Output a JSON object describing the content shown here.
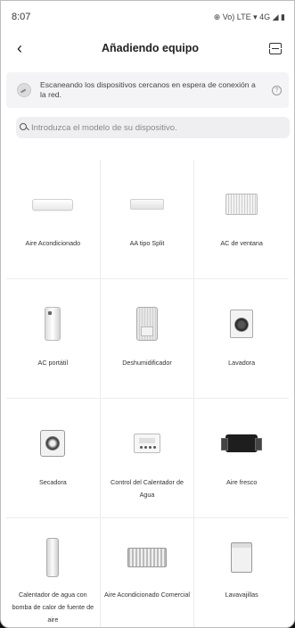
{
  "status_bar": {
    "time": "8:07",
    "icons": "⊕ Vo) LTE ▾ 4G ◢ ▮"
  },
  "header": {
    "title": "Añadiendo equipo"
  },
  "scan_notice": {
    "text": "Escaneando los dispositivos cercanos en espera de conexión a la red.",
    "help": "?"
  },
  "search": {
    "placeholder": "Introduzca el modelo de su dispositivo."
  },
  "devices": [
    {
      "label": "Aire Acondicionado",
      "icon": "split-ac-icon"
    },
    {
      "label": "AA tipo Split",
      "icon": "split-ac-icon"
    },
    {
      "label": "AC de ventana",
      "icon": "window-ac-icon"
    },
    {
      "label": "AC portátil",
      "icon": "portable-ac-icon"
    },
    {
      "label": "Deshumidificador",
      "icon": "dehumidifier-icon"
    },
    {
      "label": "Lavadora",
      "icon": "washer-icon"
    },
    {
      "label": "Secadora",
      "icon": "dryer-icon"
    },
    {
      "label": "Control del Calentador de Agua",
      "icon": "water-heater-control-icon"
    },
    {
      "label": "Aire fresco",
      "icon": "fresh-air-icon"
    },
    {
      "label": "Calentador de agua con bomba de calor de fuente de aire",
      "icon": "heat-pump-water-heater-icon"
    },
    {
      "label": "Aire Acondicionado Comercial",
      "icon": "commercial-ac-icon"
    },
    {
      "label": "Lavavajillas",
      "icon": "dishwasher-icon"
    }
  ]
}
